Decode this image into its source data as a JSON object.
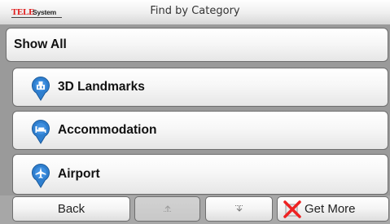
{
  "titlebar": {
    "brand_tele": "TELE",
    "brand_system": "System",
    "title": "Find by Category"
  },
  "categories": [
    {
      "label": "Show All",
      "icon": null
    },
    {
      "label": "3D Landmarks",
      "icon": "landmark-pin-icon"
    },
    {
      "label": "Accommodation",
      "icon": "bed-pin-icon"
    },
    {
      "label": "Airport",
      "icon": "airplane-pin-icon"
    }
  ],
  "toolbar": {
    "back_label": "Back",
    "scroll_up_icon": "scroll-up-icon",
    "scroll_down_icon": "scroll-down-icon",
    "get_more_label": "Get More",
    "get_more_icon": "get-more-icon"
  },
  "colors": {
    "pin_blue": "#2f7fcf",
    "brand_red": "#e11a1a",
    "get_more_red": "#e22"
  }
}
